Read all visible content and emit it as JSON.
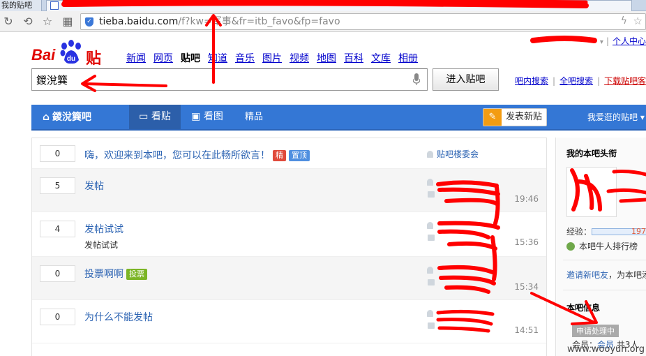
{
  "browser": {
    "inactive_tab_title": "我的贴吧",
    "url_host": "tieba.baidu.com",
    "url_path": "/f?kw=军事&fr=itb_favo&fp=favo"
  },
  "header": {
    "personal_center": "个人中心",
    "logo_bai": "Bai",
    "logo_du": "du",
    "logo_tieba": "贴吧",
    "nav": [
      "新闻",
      "网页",
      "贴吧",
      "知道",
      "音乐",
      "图片",
      "视频",
      "地图",
      "百科",
      "文库",
      "相册"
    ],
    "current_nav": "贴吧",
    "search_value": "鍐涗簨",
    "enter_button": "进入贴吧",
    "search_in_forum": "吧内搜索",
    "search_all": "全吧搜索",
    "download_client": "下载贴吧客"
  },
  "forum_bar": {
    "forum_name": "鍐涗簨吧",
    "tab_posts": "看贴",
    "tab_images": "看图",
    "tab_featured": "精品",
    "post_button": "发表新贴",
    "fav_forums": "我爱逛的贴吧 ▾",
    "bar_color": "#3477d5"
  },
  "threads": [
    {
      "replies": "0",
      "title": "嗨，欢迎来到本吧，您可以在此畅所欲言！",
      "badges": [
        "精",
        "置顶"
      ],
      "author": "贴吧楼委会",
      "time": ""
    },
    {
      "replies": "5",
      "title": "发帖",
      "badges": [],
      "author": "",
      "time": "19:46"
    },
    {
      "replies": "4",
      "title": "发帖试试",
      "subtitle": "发帖试试",
      "badges": [],
      "author": "",
      "time": "15:36"
    },
    {
      "replies": "0",
      "title": "投票啊啊",
      "badges": [
        "投票"
      ],
      "author": "",
      "time": "15:34"
    },
    {
      "replies": "0",
      "title": "为什么不能发帖",
      "badges": [],
      "author": "",
      "time": "14:51"
    }
  ],
  "sidebar": {
    "head_title": "我的本吧头衔",
    "exp_label": "经验：",
    "exp_value": "197",
    "rank_link": "本吧牛人排行榜",
    "invite_link": "邀请新吧友",
    "invite_suffix": "，为本吧添",
    "info_title": "本吧信息",
    "pending": "申请处理中",
    "members_label": "会员：",
    "members_link": "会员",
    "members_count": "共3人"
  },
  "watermark": "www.wooyun.org"
}
